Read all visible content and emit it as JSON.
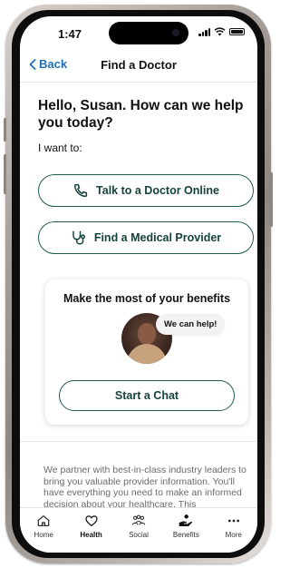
{
  "status_bar": {
    "time": "1:47"
  },
  "nav": {
    "back_label": "Back",
    "title": "Find a Doctor"
  },
  "greeting": "Hello, Susan.  How can we help you today?",
  "intent_label": "I want to:",
  "actions": [
    {
      "label": "Talk to a Doctor Online",
      "icon": "phone-icon"
    },
    {
      "label": "Find a Medical Provider",
      "icon": "stethoscope-icon"
    }
  ],
  "benefits_card": {
    "title": "Make the most of your benefits",
    "bubble": "We can help!",
    "button_label": "Start a Chat"
  },
  "disclaimer": "We partner with best-in-class industry leaders to bring you valuable provider information. You'll have everything you need to make an informed decision about your healthcare. This",
  "tabbar": {
    "items": [
      {
        "label": "Home",
        "icon": "home-icon"
      },
      {
        "label": "Health",
        "icon": "heart-icon",
        "active": true
      },
      {
        "label": "Social",
        "icon": "people-icon"
      },
      {
        "label": "Benefits",
        "icon": "benefits-icon"
      },
      {
        "label": "More",
        "icon": "more-icon"
      }
    ]
  },
  "colors": {
    "accent": "#1e5b52",
    "link": "#1f6fb6"
  }
}
